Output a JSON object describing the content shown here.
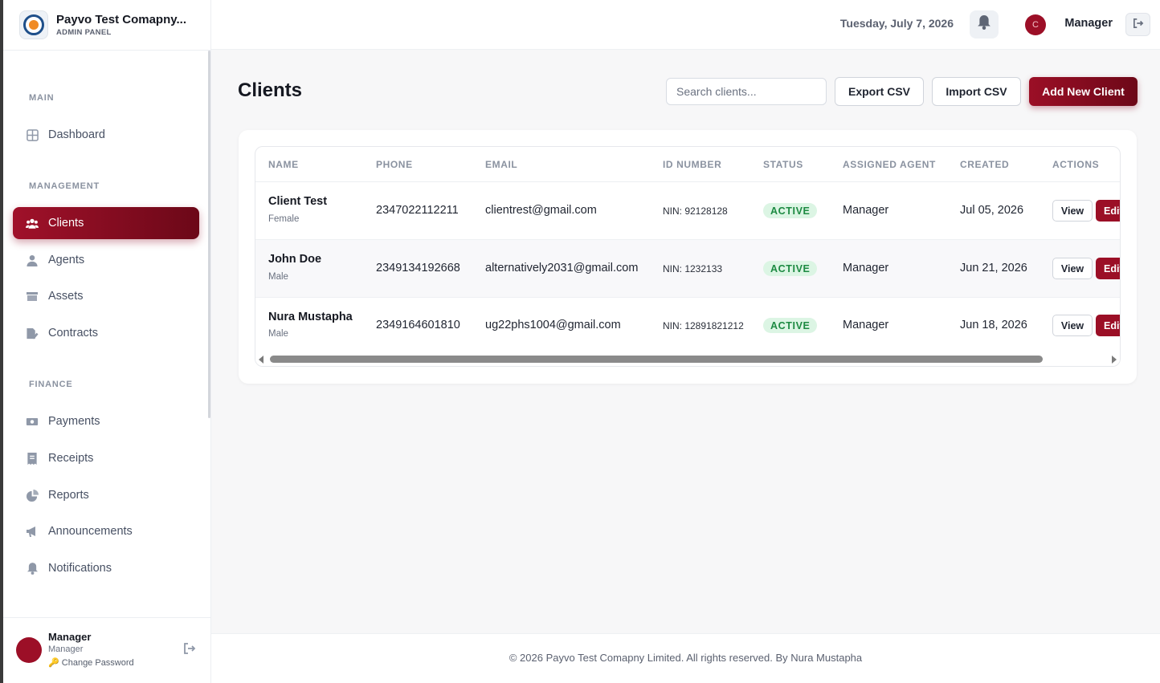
{
  "brand": {
    "name": "Payvo Test Comapny...",
    "subtitle": "ADMIN PANEL"
  },
  "sidebar": {
    "sections": [
      "MAIN",
      "MANAGEMENT",
      "FINANCE"
    ],
    "items": [
      {
        "label": "Dashboard",
        "icon": "grid-icon"
      },
      {
        "label": "Clients",
        "icon": "users-icon",
        "active": true
      },
      {
        "label": "Agents",
        "icon": "user-icon"
      },
      {
        "label": "Assets",
        "icon": "box-icon"
      },
      {
        "label": "Contracts",
        "icon": "contract-icon"
      },
      {
        "label": "Payments",
        "icon": "money-icon"
      },
      {
        "label": "Receipts",
        "icon": "receipt-icon"
      },
      {
        "label": "Reports",
        "icon": "pie-chart-icon"
      },
      {
        "label": "Announcements",
        "icon": "megaphone-icon"
      },
      {
        "label": "Notifications",
        "icon": "bell-icon"
      }
    ],
    "user": {
      "name": "Manager",
      "role": "Manager",
      "change_password": "Change Password"
    }
  },
  "header": {
    "date": "Tuesday, July 7, 2026",
    "avatar_initial": "C",
    "user": "Manager"
  },
  "main": {
    "title": "Clients",
    "search_placeholder": "Search clients...",
    "export_label": "Export CSV",
    "import_label": "Import CSV",
    "add_label": "Add New Client"
  },
  "table": {
    "columns": [
      "NAME",
      "PHONE",
      "EMAIL",
      "ID NUMBER",
      "STATUS",
      "ASSIGNED AGENT",
      "CREATED",
      "ACTIONS"
    ],
    "rows": [
      {
        "name": "Client Test",
        "gender": "Female",
        "phone": "2347022112211",
        "email": "clientrest@gmail.com",
        "id": "NIN: 92128128",
        "status": "ACTIVE",
        "agent": "Manager",
        "created": "Jul 05, 2026"
      },
      {
        "name": "John Doe",
        "gender": "Male",
        "phone": "2349134192668",
        "email": "alternatively2031@gmail.com",
        "id": "NIN: 1232133",
        "status": "ACTIVE",
        "agent": "Manager",
        "created": "Jun 21, 2026"
      },
      {
        "name": "Nura Mustapha",
        "gender": "Male",
        "phone": "2349164601810",
        "email": "ug22phs1004@gmail.com",
        "id": "NIN: 12891821212",
        "status": "ACTIVE",
        "agent": "Manager",
        "created": "Jun 18, 2026"
      }
    ],
    "view_label": "View",
    "edit_label": "Edit"
  },
  "footer": {
    "text": "© 2026 Payvo Test Comapny Limited. All rights reserved. By Nura Mustapha"
  },
  "colors": {
    "accent": "#9b0f26",
    "active_badge_bg": "#dcf5e4",
    "active_badge_text": "#1d8a42"
  }
}
